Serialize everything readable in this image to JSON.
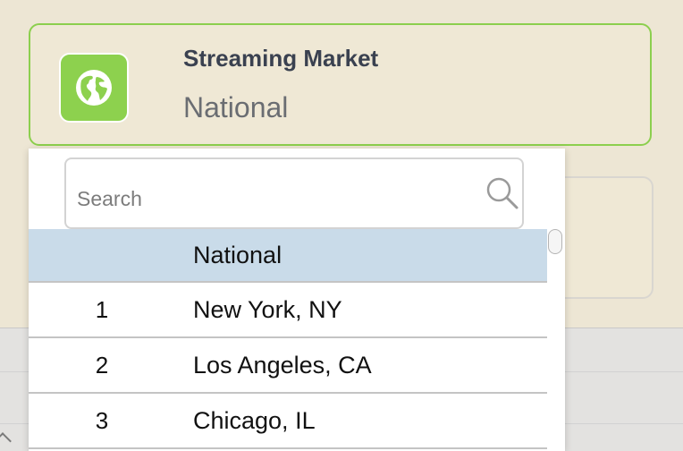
{
  "market_card": {
    "title": "Streaming Market",
    "value": "National",
    "icon": "globe-icon",
    "icon_color": "#8dd14e",
    "border_color": "#8ccf4e"
  },
  "dropdown": {
    "search": {
      "placeholder": "Search",
      "value": ""
    },
    "selected_color": "#c9dbe9",
    "options": [
      {
        "rank": "",
        "label": "National",
        "selected": true
      },
      {
        "rank": "1",
        "label": "New York, NY",
        "selected": false
      },
      {
        "rank": "2",
        "label": "Los Angeles, CA",
        "selected": false
      },
      {
        "rank": "3",
        "label": "Chicago, IL",
        "selected": false
      }
    ]
  }
}
